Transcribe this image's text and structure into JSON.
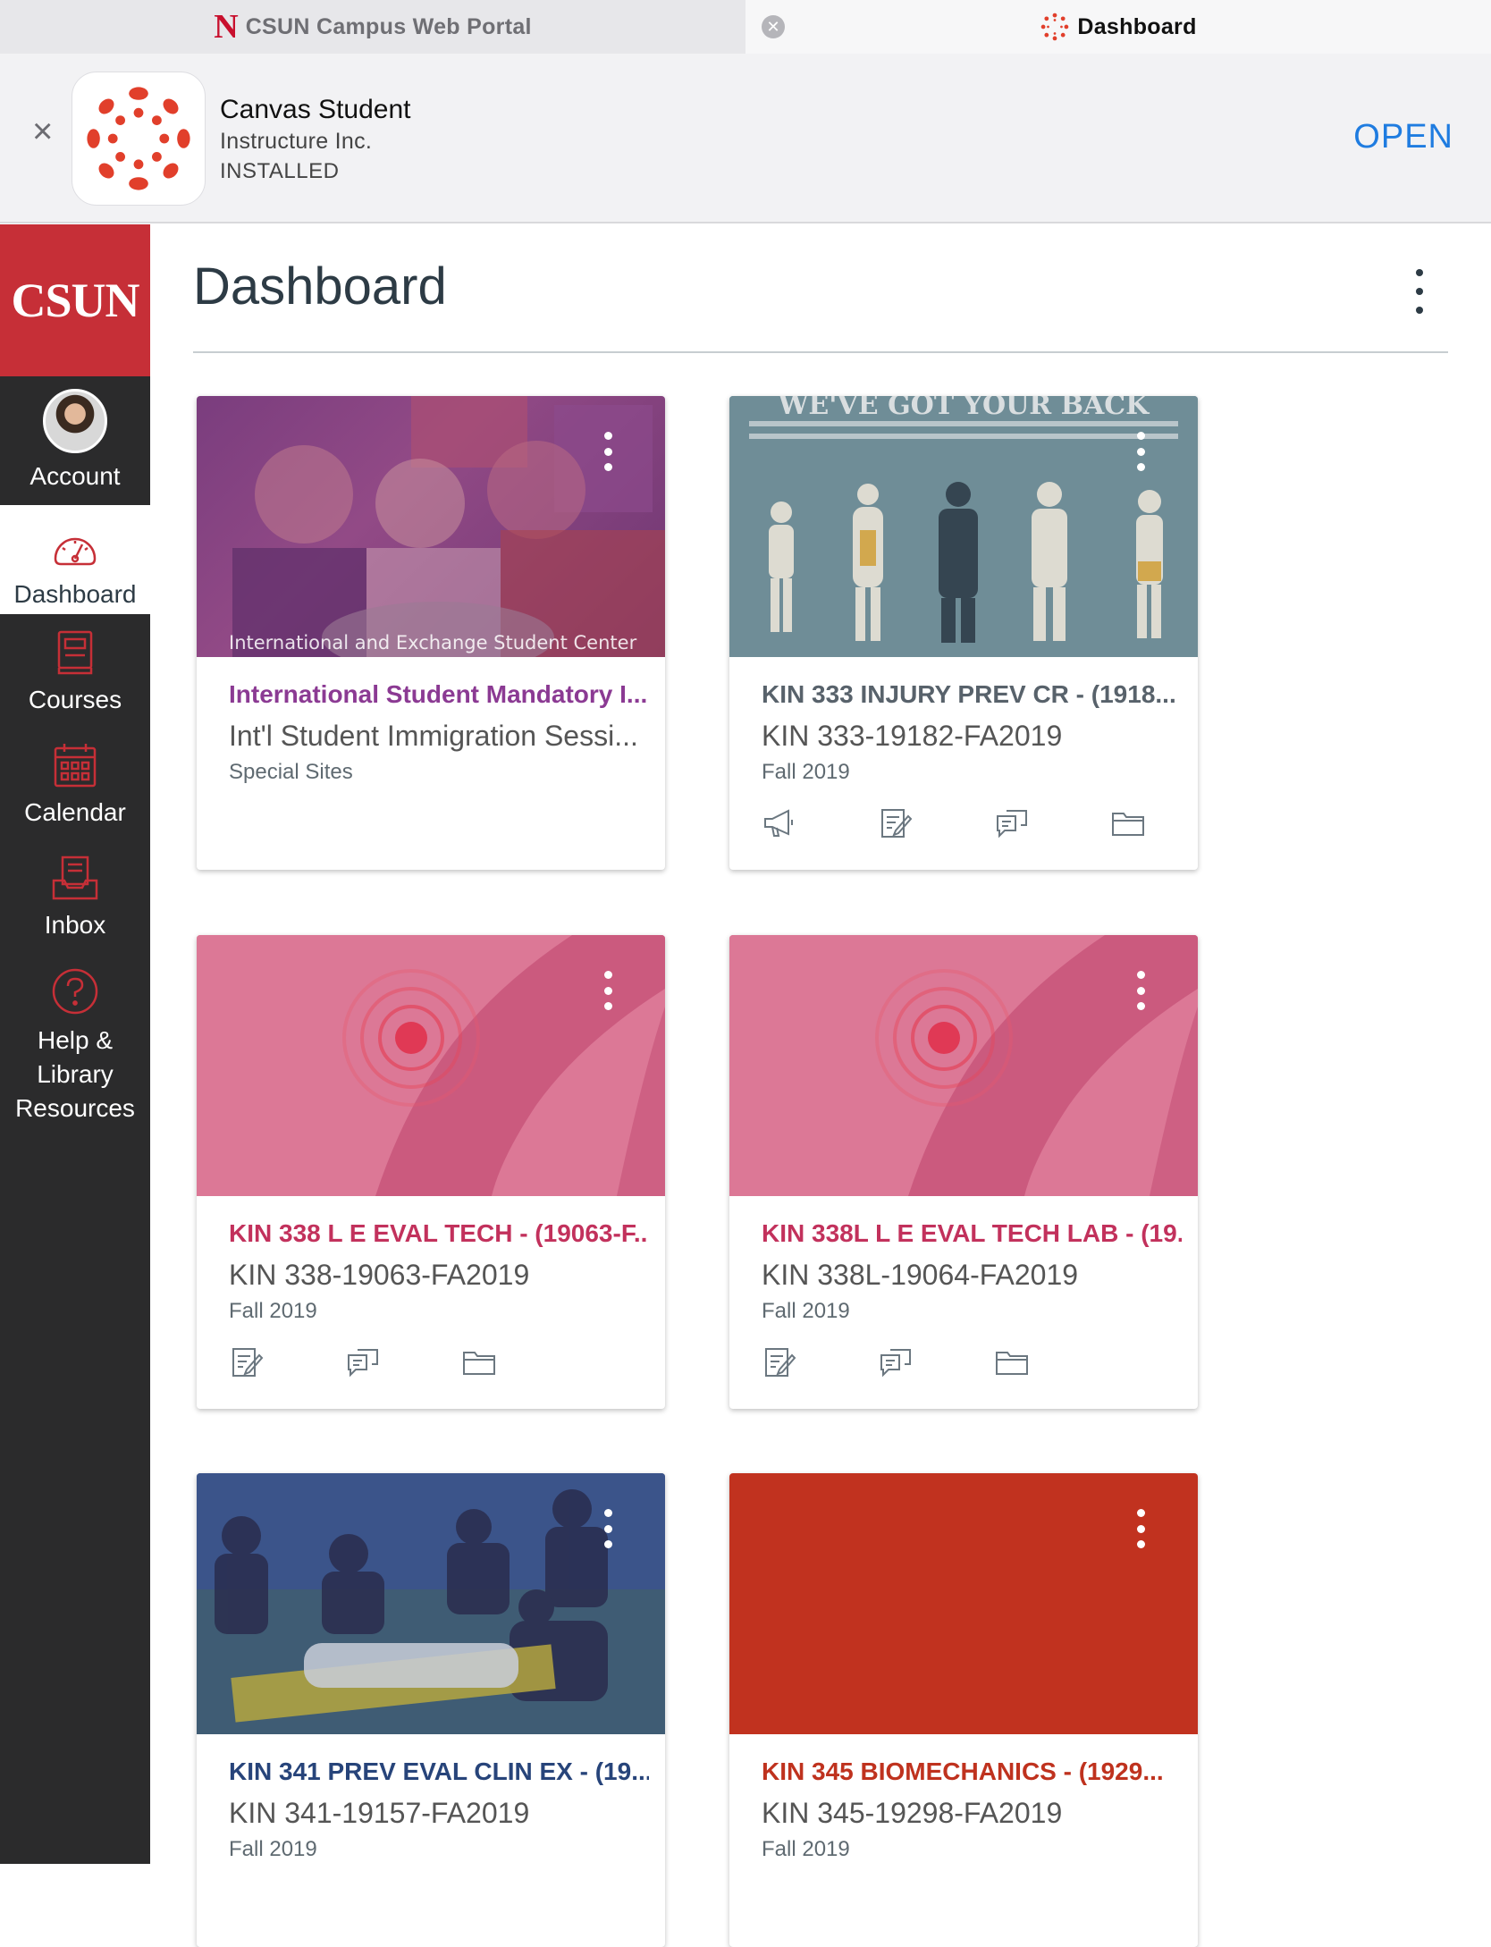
{
  "browser": {
    "tabs": [
      {
        "title": "CSUN Campus Web Portal",
        "logo": "N"
      },
      {
        "title": "Dashboard"
      }
    ]
  },
  "app_banner": {
    "name": "Canvas Student",
    "developer": "Instructure Inc.",
    "status": "INSTALLED",
    "open_label": "OPEN",
    "accent": "#e13f2b"
  },
  "sidebar": {
    "brand": "CSUN",
    "brand_color": "#c62f37",
    "items": [
      {
        "label": "Account",
        "icon": "avatar"
      },
      {
        "label": "Dashboard",
        "icon": "dashboard-gauge-icon"
      },
      {
        "label": "Courses",
        "icon": "book-icon"
      },
      {
        "label": "Calendar",
        "icon": "calendar-icon"
      },
      {
        "label": "Inbox",
        "icon": "inbox-icon"
      },
      {
        "label": "Help &\nLibrary\nResources",
        "icon": "help-icon"
      }
    ]
  },
  "dashboard": {
    "title": "Dashboard",
    "cards": [
      {
        "title": "International Student Mandatory I...",
        "subtitle": "Int'l Student Immigration Sessi...",
        "term": "Special Sites",
        "color": "#8b3a93",
        "hero_caption": "International and Exchange Student Center",
        "actions": []
      },
      {
        "title": "KIN 333 INJURY PREV CR - (1918...",
        "subtitle": "KIN 333-19182-FA2019",
        "term": "Fall 2019",
        "color": "#58626b",
        "hero_caption": "WE'VE GOT YOUR BACK",
        "actions": [
          "announcements-icon",
          "assignments-icon",
          "discussions-icon",
          "files-icon"
        ]
      },
      {
        "title": "KIN 338 L E EVAL TECH - (19063-F...",
        "subtitle": "KIN 338-19063-FA2019",
        "term": "Fall 2019",
        "color": "#c2315c",
        "actions": [
          "assignments-icon",
          "discussions-icon",
          "files-icon"
        ]
      },
      {
        "title": "KIN 338L L E EVAL TECH LAB - (19...",
        "subtitle": "KIN 338L-19064-FA2019",
        "term": "Fall 2019",
        "color": "#c2315c",
        "actions": [
          "assignments-icon",
          "discussions-icon",
          "files-icon"
        ]
      },
      {
        "title": "KIN 341 PREV EVAL CLIN EX - (19...",
        "subtitle": "KIN 341-19157-FA2019",
        "term": "Fall 2019",
        "color": "#27447a",
        "actions": []
      },
      {
        "title": "KIN 345 BIOMECHANICS - (1929...",
        "subtitle": "KIN 345-19298-FA2019",
        "term": "Fall 2019",
        "color": "#bf321e",
        "actions": []
      }
    ]
  }
}
